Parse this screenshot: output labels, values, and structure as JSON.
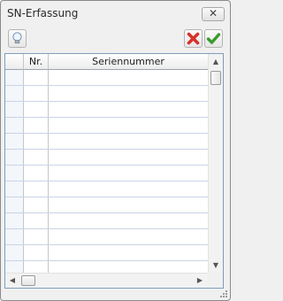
{
  "window": {
    "title": "SN-Erfassung",
    "close_glyph": "✕"
  },
  "toolbar": {
    "hint_icon": "lightbulb-icon",
    "cancel_icon": "red-x-icon",
    "confirm_icon": "green-check-icon"
  },
  "table": {
    "columns": [
      "",
      "Nr.",
      "Seriennummer"
    ],
    "rows": [
      {
        "nr": "",
        "sn": ""
      },
      {
        "nr": "",
        "sn": ""
      },
      {
        "nr": "",
        "sn": ""
      },
      {
        "nr": "",
        "sn": ""
      },
      {
        "nr": "",
        "sn": ""
      },
      {
        "nr": "",
        "sn": ""
      },
      {
        "nr": "",
        "sn": ""
      },
      {
        "nr": "",
        "sn": ""
      },
      {
        "nr": "",
        "sn": ""
      },
      {
        "nr": "",
        "sn": ""
      },
      {
        "nr": "",
        "sn": ""
      },
      {
        "nr": "",
        "sn": ""
      },
      {
        "nr": "",
        "sn": ""
      }
    ]
  },
  "scroll": {
    "up": "▲",
    "down": "▼",
    "left": "◀",
    "right": "▶"
  },
  "colors": {
    "grid_line": "#c9d4e4",
    "border": "#7f9db9",
    "cancel": "#d8322a",
    "confirm": "#3a9a2e"
  }
}
